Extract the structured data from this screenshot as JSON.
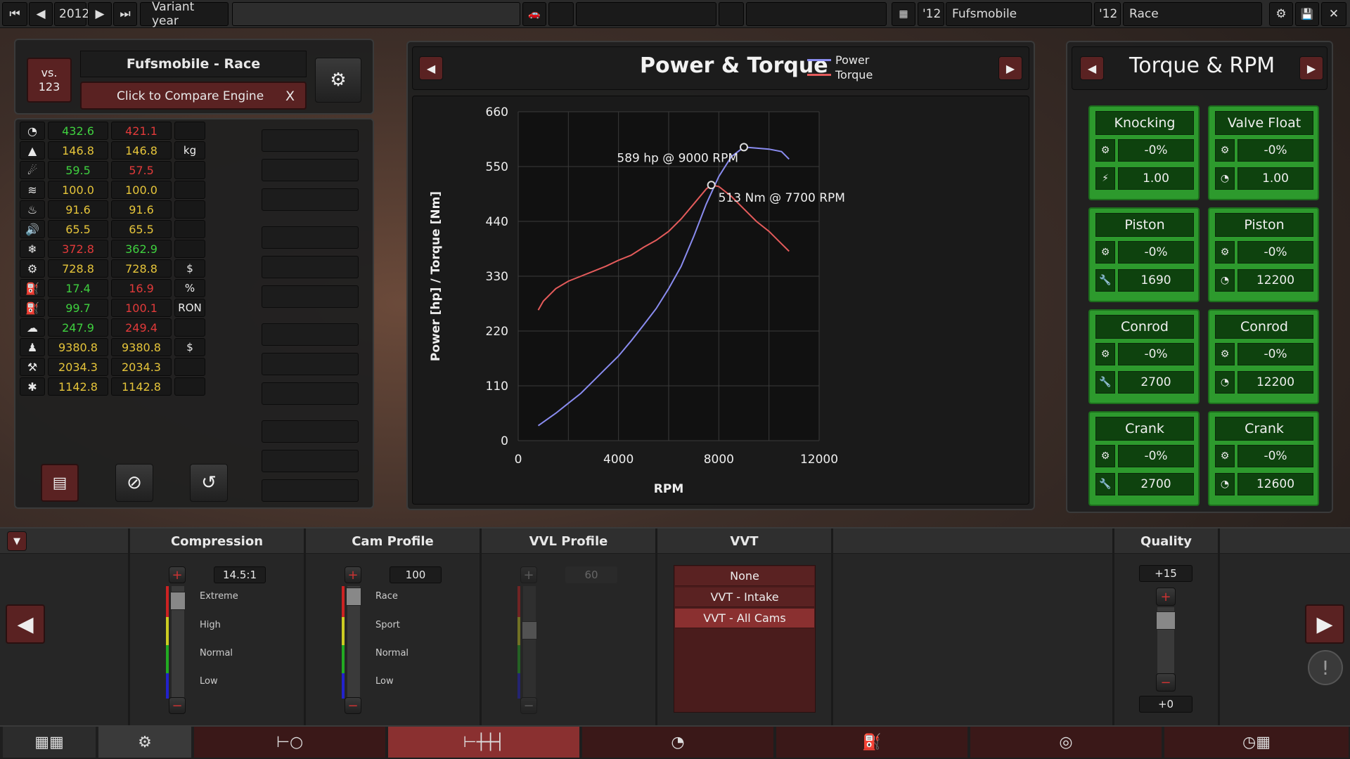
{
  "topbar": {
    "year": "2012",
    "variant_label": "Variant year",
    "engine_year": "'12",
    "engine_name": "Fufsmobile",
    "variant_year": "'12",
    "variant_name": "Race"
  },
  "compare": {
    "vs_label": "vs.\n123",
    "engine_title": "Fufsmobile - Race",
    "compare_button": "Click to Compare Engine",
    "close_label": "X"
  },
  "stats": [
    {
      "icon": "speedometer-icon",
      "a": "432.6",
      "a_color": "green",
      "b": "421.1",
      "b_color": "red",
      "unit": ""
    },
    {
      "icon": "weight-icon",
      "a": "146.8",
      "a_color": "yellow",
      "b": "146.8",
      "b_color": "yellow",
      "unit": "kg"
    },
    {
      "icon": "engine-response-icon",
      "a": "59.5",
      "a_color": "green",
      "b": "57.5",
      "b_color": "red",
      "unit": ""
    },
    {
      "icon": "smoothness-icon",
      "a": "100.0",
      "a_color": "yellow",
      "b": "100.0",
      "b_color": "yellow",
      "unit": ""
    },
    {
      "icon": "heat-icon",
      "a": "91.6",
      "a_color": "yellow",
      "b": "91.6",
      "b_color": "yellow",
      "unit": ""
    },
    {
      "icon": "noise-icon",
      "a": "65.5",
      "a_color": "yellow",
      "b": "65.5",
      "b_color": "yellow",
      "unit": ""
    },
    {
      "icon": "cooling-icon",
      "a": "372.8",
      "a_color": "red",
      "b": "362.9",
      "b_color": "green",
      "unit": ""
    },
    {
      "icon": "cost-icon",
      "a": "728.8",
      "a_color": "yellow",
      "b": "728.8",
      "b_color": "yellow",
      "unit": "$"
    },
    {
      "icon": "efficiency-icon",
      "a": "17.4",
      "a_color": "green",
      "b": "16.9",
      "b_color": "red",
      "unit": "%"
    },
    {
      "icon": "fuel-pump-icon",
      "a": "99.7",
      "a_color": "green",
      "b": "100.1",
      "b_color": "red",
      "unit": "RON"
    },
    {
      "icon": "emissions-icon",
      "a": "247.9",
      "a_color": "green",
      "b": "249.4",
      "b_color": "red",
      "unit": ""
    },
    {
      "icon": "engineering-cost-icon",
      "a": "9380.8",
      "a_color": "yellow",
      "b": "9380.8",
      "b_color": "yellow",
      "unit": "$"
    },
    {
      "icon": "production-units-icon",
      "a": "2034.3",
      "a_color": "yellow",
      "b": "2034.3",
      "b_color": "yellow",
      "unit": ""
    },
    {
      "icon": "service-cost-icon",
      "a": "1142.8",
      "a_color": "yellow",
      "b": "1142.8",
      "b_color": "yellow",
      "unit": ""
    }
  ],
  "graph": {
    "title": "Power & Torque",
    "legend_power": "Power",
    "legend_torque": "Torque",
    "power_annotation": "589 hp @ 9000 RPM",
    "torque_annotation": "513 Nm @ 7700 RPM",
    "colors": {
      "power": "#8a8cf0",
      "torque": "#e45b5b",
      "grid": "#3a3a3a"
    }
  },
  "chart_data": {
    "type": "line",
    "xlabel": "RPM",
    "ylabel": "Power [hp] / Torque [Nm]",
    "xlim": [
      0,
      12000
    ],
    "ylim": [
      0,
      660
    ],
    "xticks": [
      "0",
      "4000",
      "8000",
      "12000"
    ],
    "yticks": [
      "0",
      "110",
      "220",
      "330",
      "440",
      "550",
      "660"
    ],
    "series": [
      {
        "name": "Power",
        "x": [
          800,
          1500,
          2000,
          2500,
          3000,
          3500,
          4000,
          4500,
          5000,
          5500,
          6000,
          6500,
          7000,
          7500,
          8000,
          8500,
          9000,
          9500,
          10000,
          10500,
          10800
        ],
        "values": [
          30,
          55,
          75,
          95,
          120,
          145,
          170,
          200,
          232,
          265,
          305,
          350,
          410,
          475,
          530,
          570,
          589,
          587,
          585,
          580,
          565
        ]
      },
      {
        "name": "Torque",
        "x": [
          800,
          1000,
          1500,
          2000,
          2500,
          3000,
          3500,
          4000,
          4500,
          5000,
          5500,
          6000,
          6500,
          7000,
          7500,
          7700,
          8000,
          8500,
          9000,
          9500,
          10000,
          10500,
          10800
        ],
        "values": [
          262,
          280,
          305,
          320,
          330,
          340,
          350,
          362,
          372,
          388,
          402,
          420,
          445,
          475,
          505,
          513,
          510,
          490,
          465,
          440,
          420,
          395,
          380
        ]
      }
    ],
    "annotations": [
      {
        "text": "589 hp @ 9000 RPM",
        "x": 9000,
        "y": 589
      },
      {
        "text": "513 Nm @ 7700 RPM",
        "x": 7700,
        "y": 513
      }
    ]
  },
  "torque_rpm": {
    "title": "Torque & RPM",
    "boxes": [
      {
        "title": "Knocking",
        "pct": "-0%",
        "icon2": "knock-icon",
        "val": "1.00"
      },
      {
        "title": "Valve Float",
        "pct": "-0%",
        "icon2": "gauge-icon",
        "val": "1.00"
      },
      {
        "title": "Piston",
        "pct": "-0%",
        "icon2": "wrench-icon",
        "val": "1690"
      },
      {
        "title": "Piston",
        "pct": "-0%",
        "icon2": "gauge-icon",
        "val": "12200"
      },
      {
        "title": "Conrod",
        "pct": "-0%",
        "icon2": "wrench-icon",
        "val": "2700"
      },
      {
        "title": "Conrod",
        "pct": "-0%",
        "icon2": "gauge-icon",
        "val": "12200"
      },
      {
        "title": "Crank",
        "pct": "-0%",
        "icon2": "wrench-icon",
        "val": "2700"
      },
      {
        "title": "Crank",
        "pct": "-0%",
        "icon2": "gauge-icon",
        "val": "12600"
      }
    ]
  },
  "tuning": {
    "compression": {
      "header": "Compression",
      "value": "14.5:1",
      "levels": [
        "Extreme",
        "High",
        "Normal",
        "Low"
      ]
    },
    "cam": {
      "header": "Cam Profile",
      "value": "100",
      "levels": [
        "Race",
        "Sport",
        "Normal",
        "Low"
      ]
    },
    "vvl": {
      "header": "VVL Profile",
      "value": "60"
    },
    "vvt": {
      "header": "VVT",
      "options": [
        "None",
        "VVT - Intake",
        "VVT - All Cams"
      ],
      "selected": "VVT - All Cams"
    },
    "quality": {
      "header": "Quality",
      "top": "+15",
      "bottom": "+0"
    }
  }
}
